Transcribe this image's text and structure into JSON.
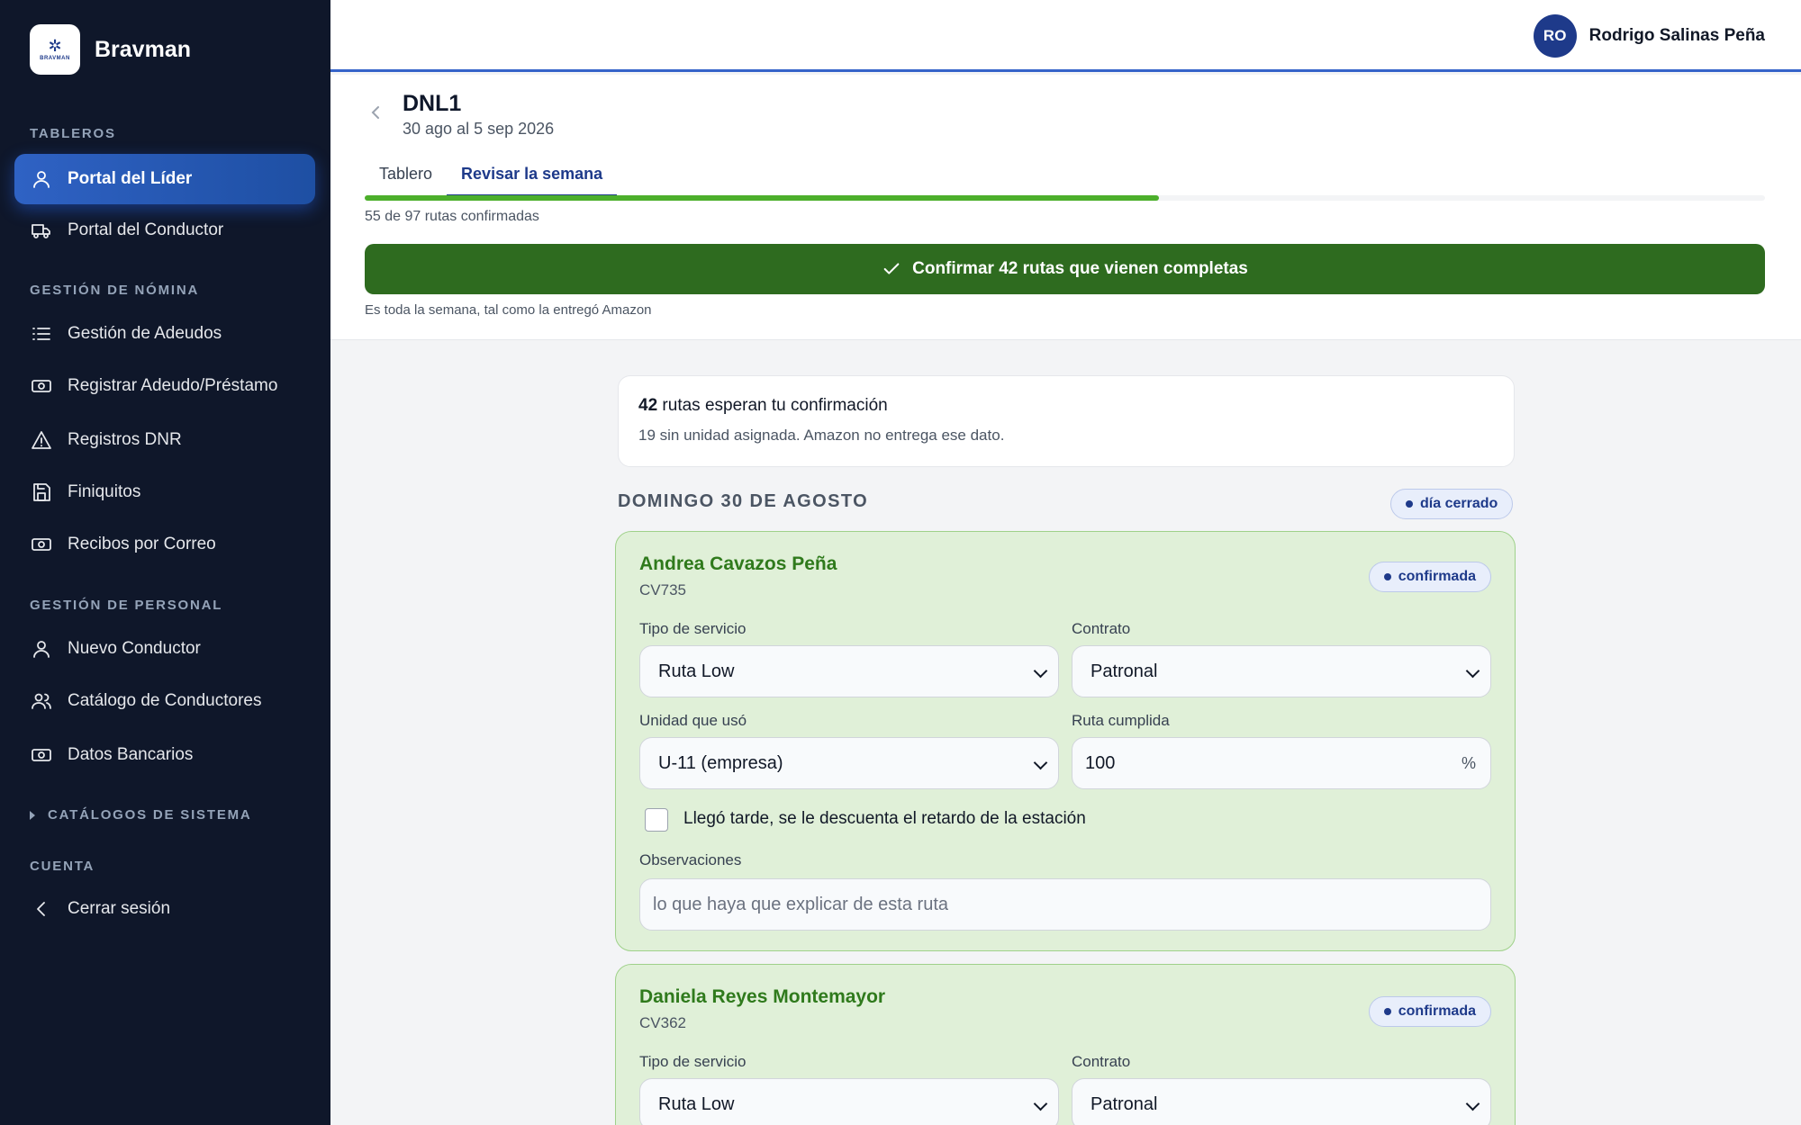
{
  "brand": {
    "name": "Bravman",
    "logo_text": "BRAVMAN"
  },
  "sidebar": {
    "sections": [
      {
        "title": "TABLEROS"
      },
      {
        "title": "GESTIÓN DE NÓMINA"
      },
      {
        "title": "GESTIÓN DE PERSONAL"
      },
      {
        "title": "CATÁLOGOS DE SISTEMA"
      },
      {
        "title": "CUENTA"
      }
    ],
    "items": [
      {
        "label": "Portal del Líder",
        "icon": "user-icon",
        "active": true
      },
      {
        "label": "Portal del Conductor",
        "icon": "truck-icon"
      },
      {
        "label": "Gestión de Adeudos",
        "icon": "list-icon"
      },
      {
        "label": "Registrar Adeudo/Préstamo",
        "icon": "cash-icon"
      },
      {
        "label": "Registros DNR",
        "icon": "warning-icon"
      },
      {
        "label": "Finiquitos",
        "icon": "save-icon"
      },
      {
        "label": "Recibos por Correo",
        "icon": "cash-icon"
      },
      {
        "label": "Nuevo Conductor",
        "icon": "user-icon"
      },
      {
        "label": "Catálogo de Conductores",
        "icon": "users-icon"
      },
      {
        "label": "Datos Bancarios",
        "icon": "cash-icon"
      },
      {
        "label": "Cerrar sesión",
        "icon": "chevron-left-icon"
      }
    ]
  },
  "user": {
    "initials": "RO",
    "name": "Rodrigo Salinas Peña"
  },
  "header": {
    "title": "DNL1",
    "subtitle": "30 ago al 5 sep 2026",
    "tabs": [
      {
        "label": "Tablero"
      },
      {
        "label": "Revisar la semana",
        "active": true
      }
    ],
    "progress": {
      "confirmed": 55,
      "total": 97,
      "text": "55 de 97 rutas confirmadas"
    },
    "confirm_button": "Confirmar 42 rutas que vienen completas",
    "confirm_note": "Es toda la semana, tal como la entregó Amazon"
  },
  "summary": {
    "count": "42",
    "line1_rest": " rutas esperan tu confirmación",
    "line2": "19 sin unidad asignada. Amazon no entrega ese dato."
  },
  "day": {
    "title": "DOMINGO 30 DE AGOSTO",
    "status": "día cerrado"
  },
  "routes": [
    {
      "driver": "Andrea Cavazos Peña",
      "code": "CV735",
      "status": "confirmada",
      "service_label": "Tipo de servicio",
      "service_value": "Ruta Low",
      "contract_label": "Contrato",
      "contract_value": "Patronal",
      "unit_label": "Unidad que usó",
      "unit_value": "U-11 (empresa)",
      "completion_label": "Ruta cumplida",
      "completion_value": "100",
      "completion_unit": "%",
      "late_label": "Llegó tarde, se le descuenta el retardo de la estación",
      "notes_label": "Observaciones",
      "notes_placeholder": "lo que haya que explicar de esta ruta"
    },
    {
      "driver": "Daniela Reyes Montemayor",
      "code": "CV362",
      "status": "confirmada",
      "service_label": "Tipo de servicio",
      "service_value": "Ruta Low",
      "contract_label": "Contrato",
      "contract_value": "Patronal"
    }
  ],
  "colors": {
    "sidebar_bg": "#0f172a",
    "accent": "#1e3a8a",
    "confirm_green": "#2e6b1f",
    "card_green": "#e0f0d8"
  }
}
